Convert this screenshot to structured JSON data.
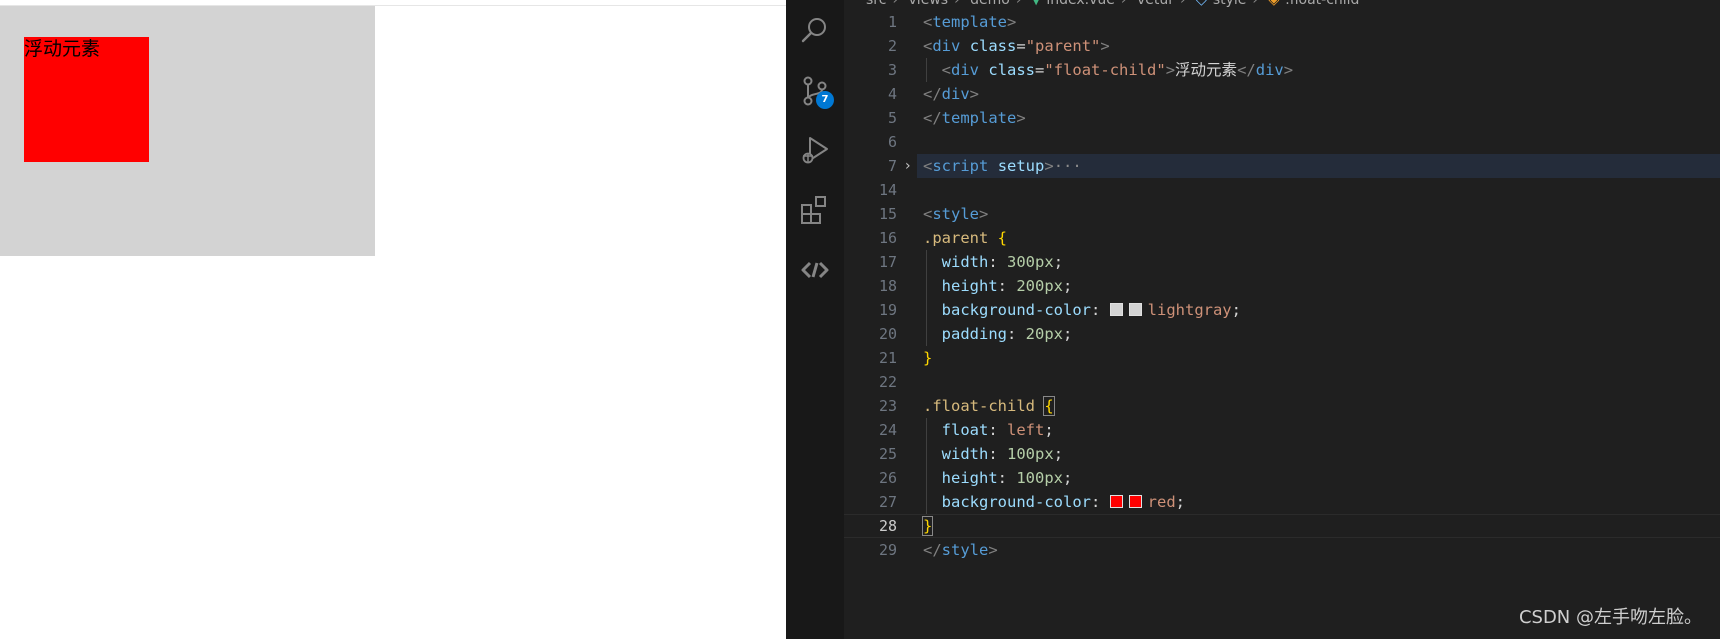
{
  "preview": {
    "child_text": "浮动元素",
    "colors": {
      "parent_bg": "#d3d3d3",
      "child_bg": "#ff0000"
    }
  },
  "activity_bar": {
    "icons": [
      "search-icon",
      "source-control-icon",
      "run-debug-icon",
      "extensions-icon",
      "remote-icon"
    ],
    "scm_badge": "7"
  },
  "breadcrumb": {
    "items": [
      "src",
      "views",
      "demo",
      "index.vue",
      "vetur",
      "style",
      ".float-child"
    ]
  },
  "editor": {
    "active_line": "28",
    "lines": [
      {
        "num": "1",
        "tokens": [
          [
            "tag",
            "<"
          ],
          [
            "name",
            "template"
          ],
          [
            "tag",
            ">"
          ]
        ]
      },
      {
        "num": "2",
        "tokens": [
          [
            "tag",
            "<"
          ],
          [
            "name",
            "div"
          ],
          [
            "txt",
            " "
          ],
          [
            "attr",
            "class"
          ],
          [
            "punct",
            "="
          ],
          [
            "str",
            "\"parent\""
          ],
          [
            "tag",
            ">"
          ]
        ]
      },
      {
        "num": "3",
        "indent": true,
        "tokens": [
          [
            "txt",
            "  "
          ],
          [
            "tag",
            "<"
          ],
          [
            "name",
            "div"
          ],
          [
            "txt",
            " "
          ],
          [
            "attr",
            "class"
          ],
          [
            "punct",
            "="
          ],
          [
            "str",
            "\"float-child\""
          ],
          [
            "tag",
            ">"
          ],
          [
            "txt",
            "浮动元素"
          ],
          [
            "tag",
            "</"
          ],
          [
            "name",
            "div"
          ],
          [
            "tag",
            ">"
          ]
        ]
      },
      {
        "num": "4",
        "tokens": [
          [
            "tag",
            "</"
          ],
          [
            "name",
            "div"
          ],
          [
            "tag",
            ">"
          ]
        ]
      },
      {
        "num": "5",
        "tokens": [
          [
            "tag",
            "</"
          ],
          [
            "name",
            "template"
          ],
          [
            "tag",
            ">"
          ]
        ]
      },
      {
        "num": "6",
        "tokens": []
      },
      {
        "num": "7",
        "folded": true,
        "tokens": [
          [
            "tag",
            "<"
          ],
          [
            "name",
            "script"
          ],
          [
            "txt",
            " "
          ],
          [
            "attr",
            "setup"
          ],
          [
            "tag",
            ">"
          ],
          [
            "ellipsis",
            "···"
          ]
        ]
      },
      {
        "num": "14",
        "tokens": []
      },
      {
        "num": "15",
        "tokens": [
          [
            "tag",
            "<"
          ],
          [
            "name",
            "style"
          ],
          [
            "tag",
            ">"
          ]
        ]
      },
      {
        "num": "16",
        "tokens": [
          [
            "sel",
            ".parent"
          ],
          [
            "txt",
            " "
          ],
          [
            "brace",
            "{"
          ]
        ]
      },
      {
        "num": "17",
        "indent": true,
        "tokens": [
          [
            "txt",
            "  "
          ],
          [
            "prop",
            "width"
          ],
          [
            "punct",
            ": "
          ],
          [
            "num",
            "300px"
          ],
          [
            "punct",
            ";"
          ]
        ]
      },
      {
        "num": "18",
        "indent": true,
        "tokens": [
          [
            "txt",
            "  "
          ],
          [
            "prop",
            "height"
          ],
          [
            "punct",
            ": "
          ],
          [
            "num",
            "200px"
          ],
          [
            "punct",
            ";"
          ]
        ]
      },
      {
        "num": "19",
        "indent": true,
        "tokens": [
          [
            "txt",
            "  "
          ],
          [
            "prop",
            "background-color"
          ],
          [
            "punct",
            ": "
          ],
          [
            "swatch",
            "#d3d3d3"
          ],
          [
            "swatch",
            "#d3d3d3"
          ],
          [
            "kw",
            "lightgray"
          ],
          [
            "punct",
            ";"
          ]
        ]
      },
      {
        "num": "20",
        "indent": true,
        "tokens": [
          [
            "txt",
            "  "
          ],
          [
            "prop",
            "padding"
          ],
          [
            "punct",
            ": "
          ],
          [
            "num",
            "20px"
          ],
          [
            "punct",
            ";"
          ]
        ]
      },
      {
        "num": "21",
        "tokens": [
          [
            "brace",
            "}"
          ]
        ]
      },
      {
        "num": "22",
        "tokens": []
      },
      {
        "num": "23",
        "tokens": [
          [
            "sel",
            ".float-child"
          ],
          [
            "txt",
            " "
          ],
          [
            "bracem",
            "{"
          ]
        ]
      },
      {
        "num": "24",
        "indent": true,
        "tokens": [
          [
            "txt",
            "  "
          ],
          [
            "prop",
            "float"
          ],
          [
            "punct",
            ": "
          ],
          [
            "kw",
            "left"
          ],
          [
            "punct",
            ";"
          ]
        ]
      },
      {
        "num": "25",
        "indent": true,
        "tokens": [
          [
            "txt",
            "  "
          ],
          [
            "prop",
            "width"
          ],
          [
            "punct",
            ": "
          ],
          [
            "num",
            "100px"
          ],
          [
            "punct",
            ";"
          ]
        ]
      },
      {
        "num": "26",
        "indent": true,
        "tokens": [
          [
            "txt",
            "  "
          ],
          [
            "prop",
            "height"
          ],
          [
            "punct",
            ": "
          ],
          [
            "num",
            "100px"
          ],
          [
            "punct",
            ";"
          ]
        ]
      },
      {
        "num": "27",
        "indent": true,
        "tokens": [
          [
            "txt",
            "  "
          ],
          [
            "prop",
            "background-color"
          ],
          [
            "punct",
            ": "
          ],
          [
            "swatch",
            "#ff0000"
          ],
          [
            "swatch",
            "#ff0000"
          ],
          [
            "kw",
            "red"
          ],
          [
            "punct",
            ";"
          ]
        ]
      },
      {
        "num": "28",
        "current": true,
        "tokens": [
          [
            "bracem",
            "}"
          ]
        ]
      },
      {
        "num": "29",
        "tokens": [
          [
            "tag",
            "</"
          ],
          [
            "name",
            "style"
          ],
          [
            "tag",
            ">"
          ]
        ]
      }
    ]
  },
  "watermark": "CSDN @左手吻左脸。"
}
